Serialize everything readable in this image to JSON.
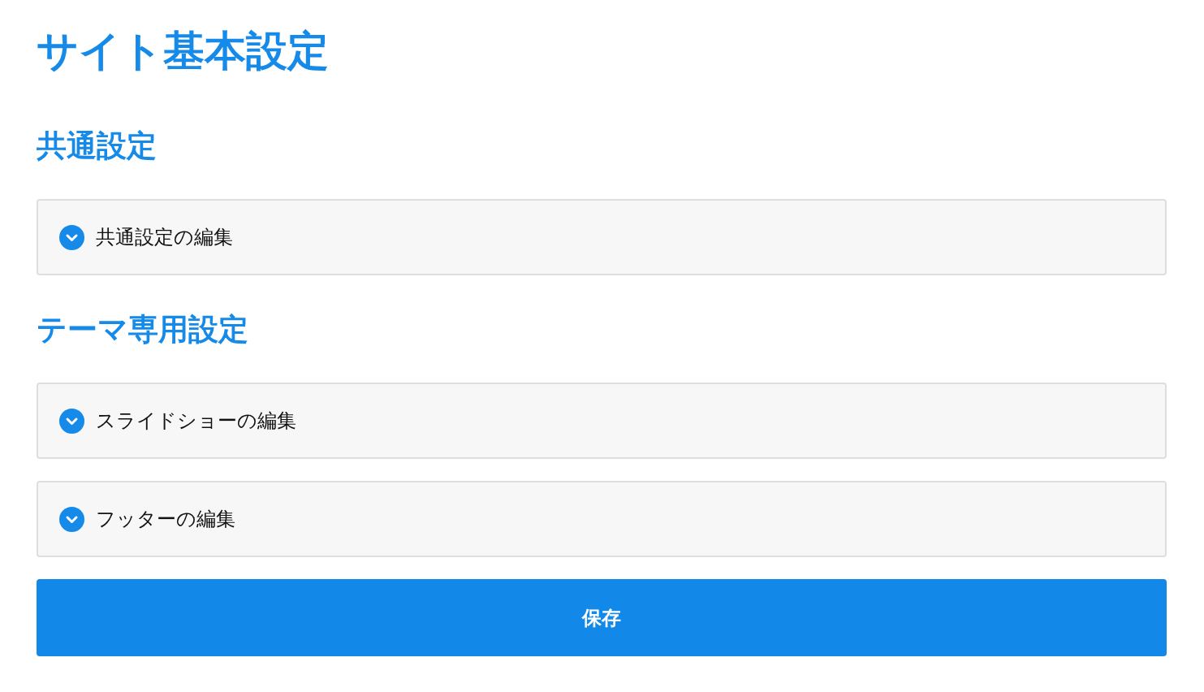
{
  "title": "サイト基本設定",
  "sections": [
    {
      "heading": "共通設定",
      "panels": [
        {
          "label": "共通設定の編集",
          "expanded": false
        }
      ]
    },
    {
      "heading": "テーマ専用設定",
      "panels": [
        {
          "label": "スライドショーの編集",
          "expanded": false
        },
        {
          "label": "フッターの編集",
          "expanded": false
        }
      ]
    }
  ],
  "save_button": {
    "label": "保存"
  }
}
